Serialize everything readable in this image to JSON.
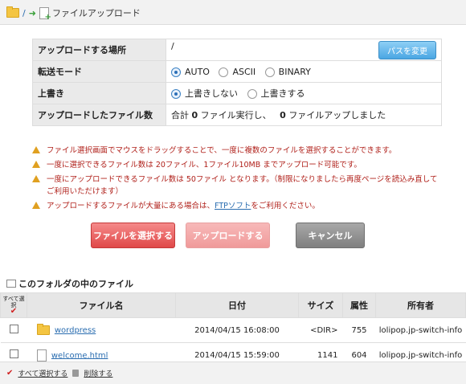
{
  "topbar": {
    "root_sep": "/",
    "title": "ファイルアップロード"
  },
  "info": {
    "row1": {
      "label": "アップロードする場所",
      "value": "/",
      "button": "パスを変更"
    },
    "row2": {
      "label": "転送モード",
      "options": [
        "AUTO",
        "ASCII",
        "BINARY"
      ],
      "selected": "AUTO"
    },
    "row3": {
      "label": "上書き",
      "options": [
        "上書きしない",
        "上書きする"
      ],
      "selected": "上書きしない"
    },
    "row4": {
      "label": "アップロードしたファイル数",
      "t1": "合計",
      "n1": "0",
      "t2": "ファイル実行し、",
      "n2": "0",
      "t3": "ファイルアップしました"
    }
  },
  "notes": [
    "ファイル選択画面でマウスをドラッグすることで、一度に複数のファイルを選択することができます。",
    "一度に選択できるファイル数は 20ファイル、1ファイル10MB までアップロード可能です。",
    "一度にアップロードできるファイル数は 50ファイル となります。（制限になりましたら再度ページを読込み直してご利用いただけます）"
  ],
  "note4": {
    "pre": "アップロードするファイルが大量にある場合は、",
    "link": "FTPソフト",
    "post": "をご利用ください。"
  },
  "buttons": {
    "select": "ファイルを選択する",
    "upload": "アップロードする",
    "cancel": "キャンセル"
  },
  "section": {
    "title": "このフォルダの中のファイル"
  },
  "files": {
    "headers": {
      "select": "すべて選択",
      "name": "ファイル名",
      "date": "日付",
      "size": "サイズ",
      "attr": "属性",
      "owner": "所有者"
    },
    "rows": [
      {
        "name": "wordpress",
        "date": "2014/04/15 16:08:00",
        "size": "<DIR>",
        "attr": "755",
        "owner": "lolipop.jp-switch-info",
        "type": "folder"
      },
      {
        "name": "welcome.html",
        "date": "2014/04/15 15:59:00",
        "size": "1141",
        "attr": "604",
        "owner": "lolipop.jp-switch-info",
        "type": "file"
      }
    ]
  },
  "footer": {
    "select_all": "すべて選択する",
    "delete": "削除する"
  }
}
